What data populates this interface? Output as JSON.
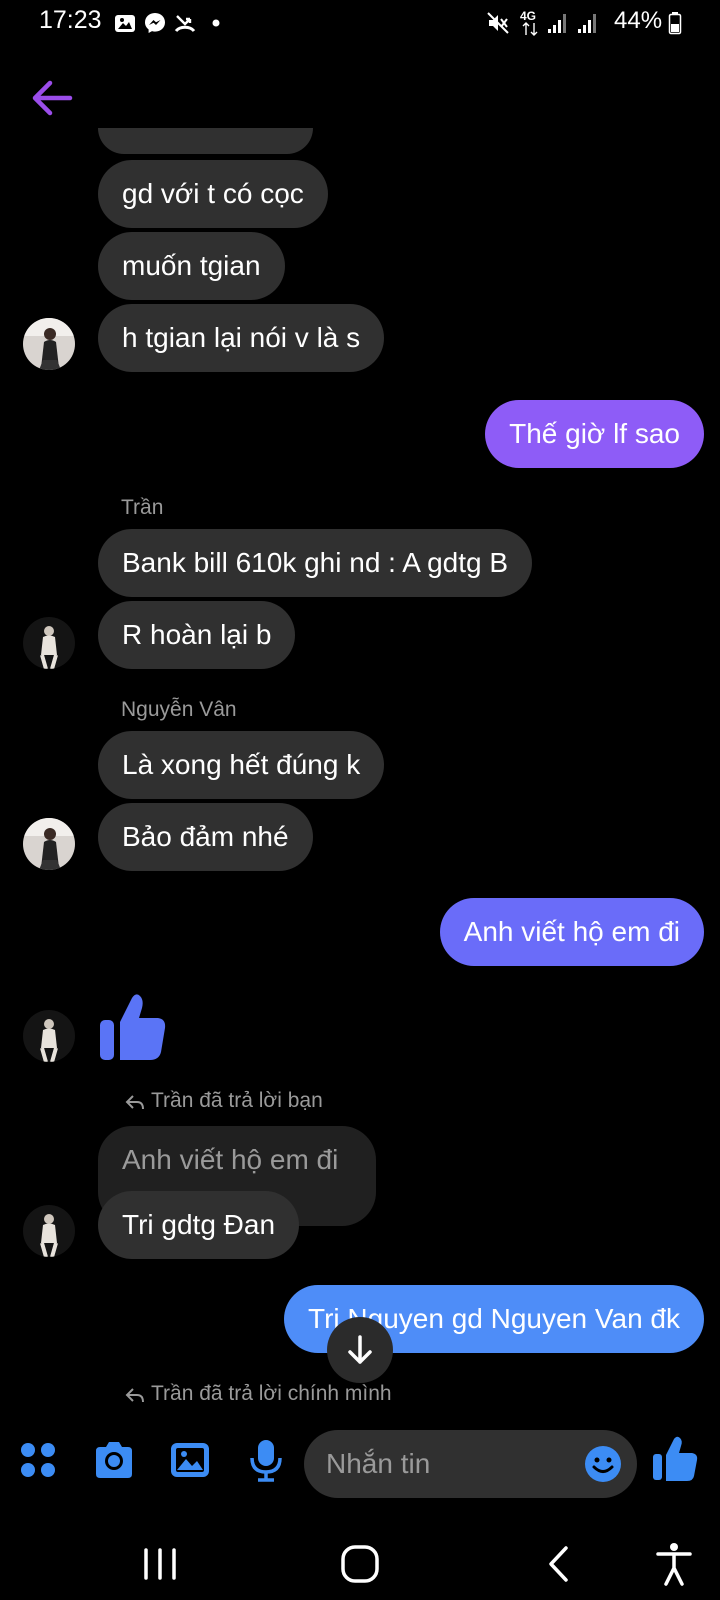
{
  "status_bar": {
    "time": "17:23",
    "network": "4G",
    "battery": "44%"
  },
  "colors": {
    "background": "#000000",
    "incoming_bubble": "#303030",
    "outgoing_bubble_purple": "#8E5CF7",
    "outgoing_bubble_blue": "#6A6CF9",
    "outgoing_bubble_light_blue": "#4E8DF8",
    "accent_blue": "#3C8CF4",
    "back_arrow": "#9B4DEA"
  },
  "header": {
    "back_icon": "arrow-left-icon"
  },
  "messages": [
    {
      "text": "gd với t có cọc"
    },
    {
      "text": "muốn tgian"
    },
    {
      "text": "h tgian lại nói v là s"
    },
    {
      "text": "Thế giờ lf sao"
    },
    {
      "sender": "Trần",
      "text": "Bank bill 610k ghi nd : A gdtg B"
    },
    {
      "text": "R hoàn lại b"
    },
    {
      "sender": "Nguyễn Vân",
      "text": "Là xong hết đúng k"
    },
    {
      "text": "Bảo đảm nhé"
    },
    {
      "text": "Anh viết hộ em đi"
    },
    {
      "reaction_icon": "thumbs-up-icon"
    },
    {
      "reply_label": "Trần đã trả lời bạn",
      "quoted": "Anh viết hộ em đi",
      "text": "Tri gdtg Đan"
    },
    {
      "text": "Tri Nguyen gd Nguyen Van đk"
    },
    {
      "reply_label": "Trần đã trả lời chính mình"
    }
  ],
  "composer": {
    "placeholder": "Nhắn tin",
    "icons": [
      "menu-dots-icon",
      "camera-icon",
      "gallery-icon",
      "microphone-icon",
      "emoji-icon",
      "thumbs-up-icon"
    ]
  },
  "nav_bar": {
    "icons": [
      "recents-icon",
      "home-icon",
      "back-icon",
      "accessibility-icon"
    ]
  }
}
